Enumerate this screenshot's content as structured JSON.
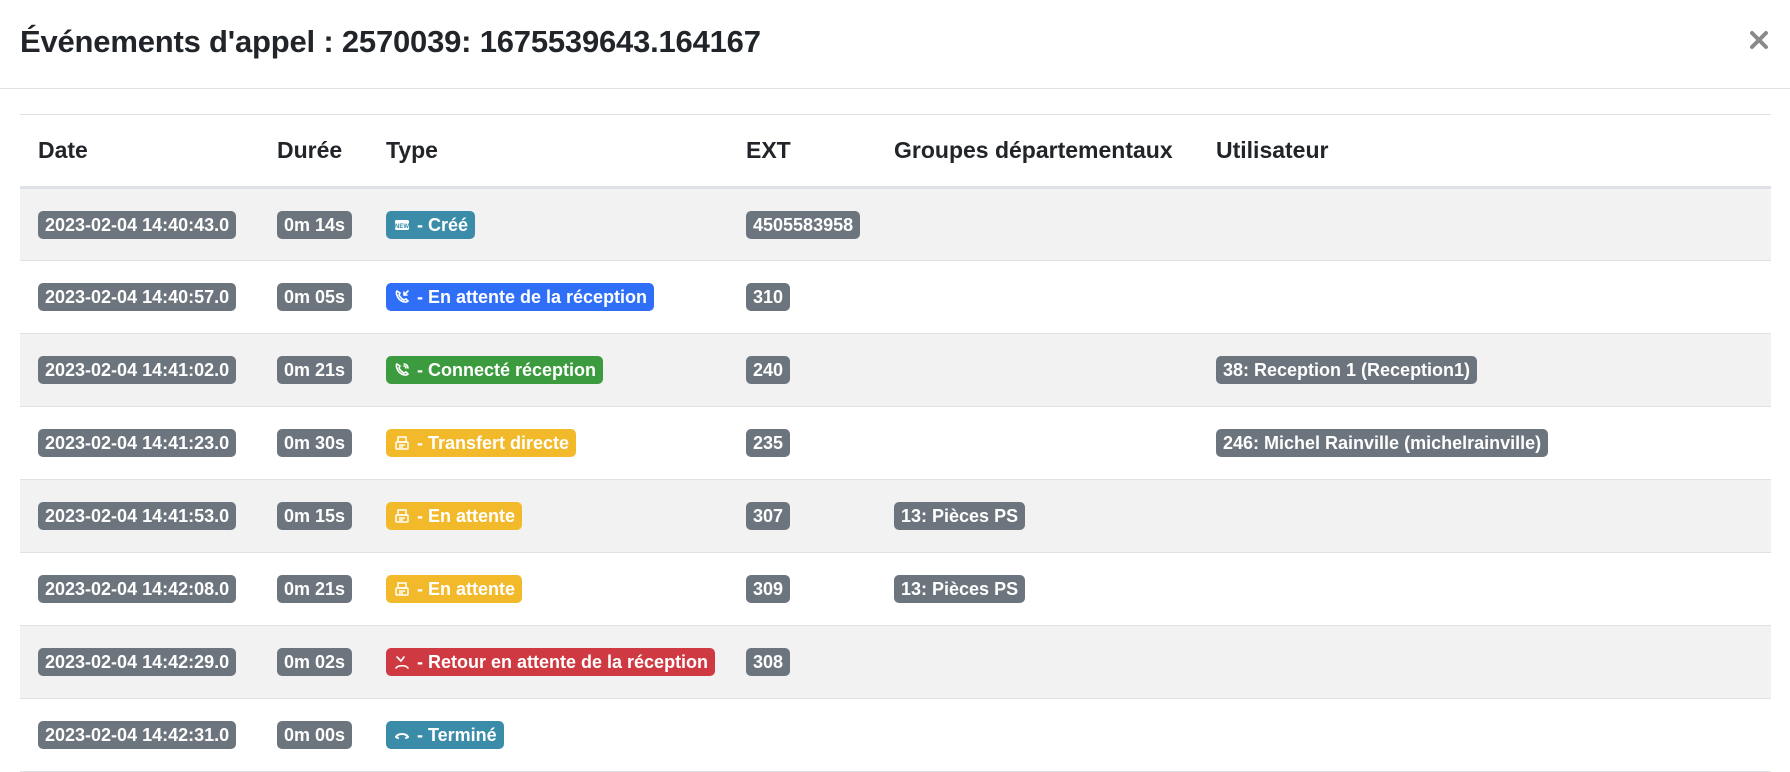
{
  "modal": {
    "title": "Événements d'appel : 2570039: 1675539643.164167",
    "close_icon": "close-icon"
  },
  "table": {
    "headers": [
      "Date",
      "Durée",
      "Type",
      "EXT",
      "Groupes départementaux",
      "Utilisateur"
    ],
    "rows": [
      {
        "date": "2023-02-04 14:40:43.0",
        "duration": "0m 14s",
        "type": "- Créé",
        "type_icon": "new-icon",
        "type_color": "#3a8ca8",
        "ext": "4505583958",
        "group": "",
        "user": ""
      },
      {
        "date": "2023-02-04 14:40:57.0",
        "duration": "0m 05s",
        "type": "- En attente de la réception",
        "type_icon": "phone-incoming-icon",
        "type_color": "#2f6ff7",
        "ext": "310",
        "group": "",
        "user": ""
      },
      {
        "date": "2023-02-04 14:41:02.0",
        "duration": "0m 21s",
        "type": "- Connecté réception",
        "type_icon": "phone-ringing-icon",
        "type_color": "#3c9a3f",
        "ext": "240",
        "group": "",
        "user": "38: Reception 1 (Reception1)"
      },
      {
        "date": "2023-02-04 14:41:23.0",
        "duration": "0m 30s",
        "type": "- Transfert directe",
        "type_icon": "fax-icon",
        "type_color": "#f2b92a",
        "ext": "235",
        "group": "",
        "user": "246: Michel Rainville (michelrainville)"
      },
      {
        "date": "2023-02-04 14:41:53.0",
        "duration": "0m 15s",
        "type": "- En attente",
        "type_icon": "fax-icon",
        "type_color": "#f2b92a",
        "ext": "307",
        "group": "13: Pièces PS",
        "user": ""
      },
      {
        "date": "2023-02-04 14:42:08.0",
        "duration": "0m 21s",
        "type": "- En attente",
        "type_icon": "fax-icon",
        "type_color": "#f2b92a",
        "ext": "309",
        "group": "13: Pièces PS",
        "user": ""
      },
      {
        "date": "2023-02-04 14:42:29.0",
        "duration": "0m 02s",
        "type": "- Retour en attente de la réception",
        "type_icon": "phone-missed-icon",
        "type_color": "#cf3a42",
        "ext": "308",
        "group": "",
        "user": ""
      },
      {
        "date": "2023-02-04 14:42:31.0",
        "duration": "0m 00s",
        "type": "- Terminé",
        "type_icon": "phone-hangup-icon",
        "type_color": "#3a8ca8",
        "ext": "",
        "group": "",
        "user": ""
      }
    ]
  }
}
